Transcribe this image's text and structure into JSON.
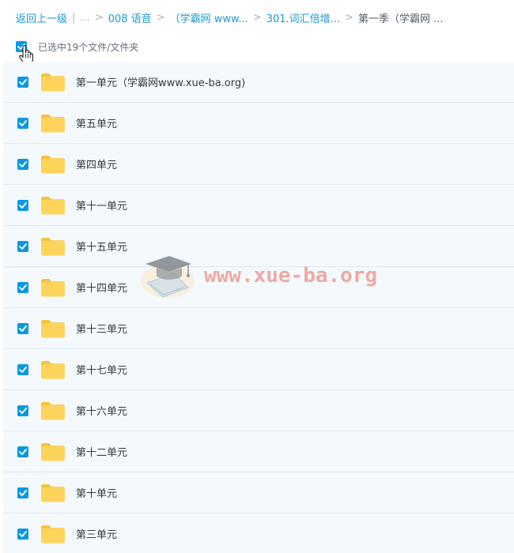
{
  "breadcrumb": {
    "back_label": "返回上一级",
    "ellipsis": "...",
    "separator": ">",
    "crumbs": [
      "008 语音",
      "（学霸网 www...",
      "301.词汇倍增...",
      "第一季（学霸网 ..."
    ]
  },
  "selection": {
    "summary": "已选中19个文件/文件夹"
  },
  "watermark": {
    "text": "www.xue-ba.org"
  },
  "folders": [
    {
      "name": "第一单元（学霸网www.xue-ba.org)"
    },
    {
      "name": "第五单元"
    },
    {
      "name": "第四单元"
    },
    {
      "name": "第十一单元"
    },
    {
      "name": "第十五单元"
    },
    {
      "name": "第十四单元"
    },
    {
      "name": "第十三单元"
    },
    {
      "name": "第十七单元"
    },
    {
      "name": "第十六单元"
    },
    {
      "name": "第十二单元"
    },
    {
      "name": "第十单元"
    },
    {
      "name": "第三单元"
    }
  ],
  "colors": {
    "accent": "#0b98e3",
    "link": "#1a9ad6",
    "folder": "#ffcf47",
    "row_bg": "#f4f9fd"
  },
  "icons": {
    "checkbox": "checkbox-checked-icon",
    "folder": "folder-icon",
    "cursor": "hand-pointer-icon"
  }
}
